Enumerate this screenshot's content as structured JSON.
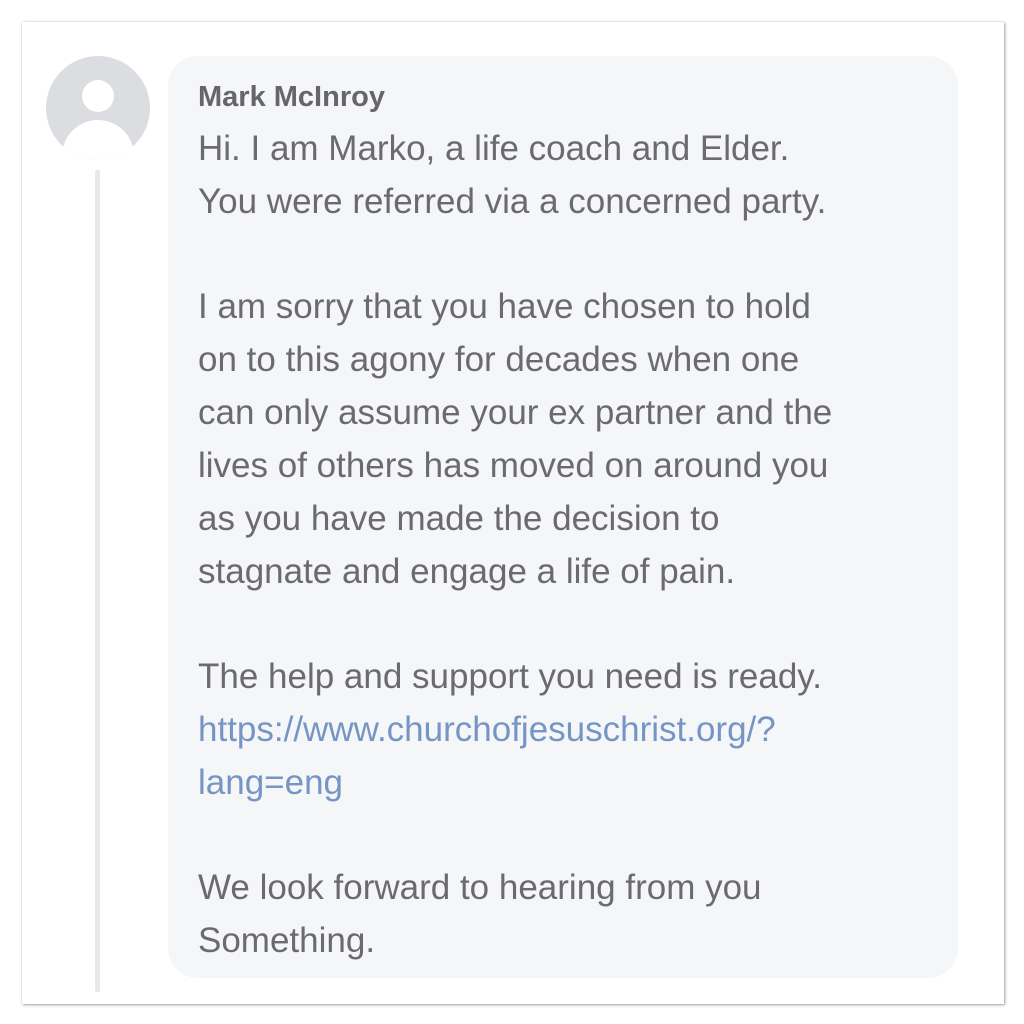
{
  "post": {
    "author": "Mark McInroy",
    "paragraphs": [
      {
        "lines": [
          "Hi. I am Marko, a life coach and Elder.",
          "You were referred via a concerned party."
        ]
      },
      {
        "lines": [
          "I am sorry that you have chosen to hold",
          "on to this agony for decades when one",
          "can only assume your ex partner and the",
          "lives of others has moved on around you",
          "as you have made the decision to",
          "stagnate and engage a life of pain."
        ]
      },
      {
        "lines": [
          "The help and support you need is ready."
        ],
        "link_lines": [
          "https://www.churchofjesuschrist.org/?",
          "lang=eng"
        ]
      },
      {
        "lines": [
          "We look forward to hearing from you",
          "Something."
        ]
      }
    ]
  },
  "colors": {
    "bubble_bg": "#f5f6f8",
    "text": "#6b6b6d",
    "author": "#666668",
    "link": "#7595c5",
    "avatar_bg": "#dcdde1",
    "thread_line": "#e7e8eb"
  },
  "icons": {
    "avatar": "default-user-avatar-icon"
  }
}
